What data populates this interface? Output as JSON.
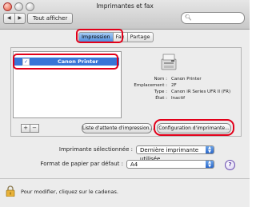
{
  "window": {
    "title": "Imprimantes et fax"
  },
  "toolbar": {
    "back_label": "◀",
    "forward_label": "▶",
    "show_all_label": "Tout afficher",
    "search_placeholder": ""
  },
  "tabs": [
    {
      "label": "Impression"
    },
    {
      "label": "Fax"
    },
    {
      "label": "Partage"
    }
  ],
  "printer_list": {
    "items": [
      {
        "name": "Canon Printer",
        "checked": true
      }
    ]
  },
  "printer_info": {
    "name_key": "Nom :",
    "name_val": "Canon Printer",
    "location_key": "Emplacement :",
    "location_val": "2F",
    "type_key": "Type :",
    "type_val": "Canon iR Series UFR II (FR)",
    "state_key": "État :",
    "state_val": "Inactif"
  },
  "list_controls": {
    "add": "+",
    "remove": "−"
  },
  "buttons": {
    "queue": "Liste d'attente d'impression...",
    "config": "Configuration d'imprimante..."
  },
  "form": {
    "selected_printer_label": "Imprimante sélectionnée :",
    "selected_printer_value": "Dernière imprimante utilisée",
    "paper_label": "Format de papier par défaut :",
    "paper_value": "A4"
  },
  "footer": {
    "lock_text": "Pour modifier, cliquez sur le cadenas."
  },
  "colors": {
    "highlight": "#e2001a",
    "selection": "#3875d7"
  }
}
